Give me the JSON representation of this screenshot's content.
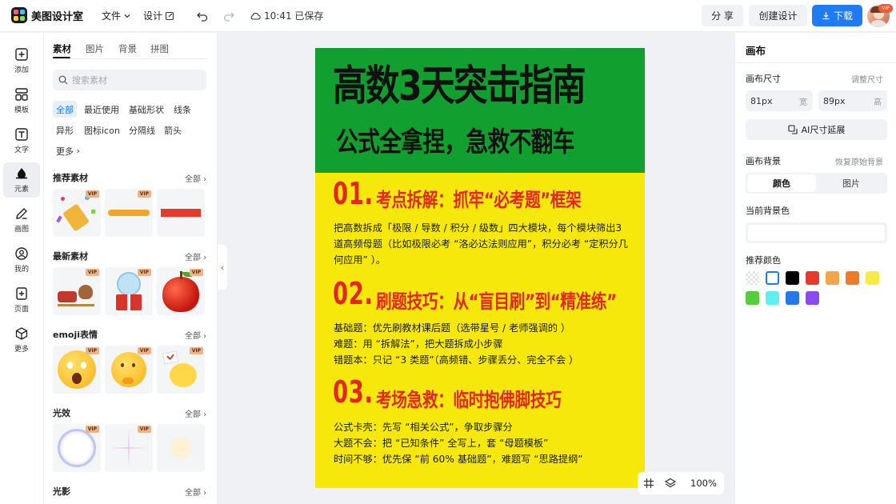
{
  "app": {
    "name": "美图设计室"
  },
  "topbar": {
    "file_label": "文件",
    "design_label": "设计",
    "saved_status": "10:41 已保存",
    "share_label": "分 享",
    "create_label": "创建设计",
    "download_label": "下载",
    "avatar_badge": "VIP"
  },
  "rail": {
    "items": [
      {
        "label": "添加",
        "icon": "plus-square-icon"
      },
      {
        "label": "模板",
        "icon": "template-icon"
      },
      {
        "label": "文字",
        "icon": "text-icon"
      },
      {
        "label": "元素",
        "icon": "shapes-icon"
      },
      {
        "label": "画图",
        "icon": "draw-icon"
      },
      {
        "label": "我的",
        "icon": "user-icon"
      },
      {
        "label": "页面",
        "icon": "page-add-icon"
      },
      {
        "label": "更多",
        "icon": "cube-icon"
      }
    ]
  },
  "panel": {
    "tabs": [
      "素材",
      "图片",
      "背景",
      "拼图"
    ],
    "search_placeholder": "搜索素材",
    "chips": [
      "全部",
      "最近使用",
      "基础形状",
      "线条",
      "异形",
      "图标icon",
      "分隔线",
      "箭头",
      "更多"
    ],
    "vip": "VIP",
    "all": "全部",
    "sections": [
      "推荐素材",
      "最新素材",
      "emoji表情",
      "光效",
      "光影"
    ]
  },
  "poster": {
    "title": "高数3天突击指南",
    "subtitle": "公式全拿捏，急救不翻车",
    "s1_num": "01.",
    "s1_head": "考点拆解：抓牢“必考题”框架",
    "s1_body": "把高数拆成「极限 / 导数 / 积分 / 级数」四大模块，每个模块筛出3 道高频母题（比如极限必考 “洛必达法则应用”，积分必考 “定积分几何应用” ）。",
    "s2_num": "02.",
    "s2_head": "刷题技巧：从“盲目刷”到“精准练”",
    "s2_line1": "基础题：优先刷教材课后题（选带星号 / 老师强调的 ）",
    "s2_line2": "难题：用 “拆解法”，把大题拆成小步骤",
    "s2_line3": "错题本：只记 “3 类题”（高频错、步骤丢分、完全不会 ）",
    "s3_num": "03.",
    "s3_head": "考场急救：临时抱佛脚技巧",
    "s3_line1": "公式卡壳：先写 “相关公式”，争取步骤分",
    "s3_line2": "大题不会：把 “已知条件” 全写上，套 “母题模板”",
    "s3_line3": "时间不够：优先保 “前 60% 基础题”，难题写 “思路提纲”"
  },
  "zoom": {
    "value": "100%"
  },
  "right_panel": {
    "title": "画布",
    "size_label": "画布尺寸",
    "adjust_size": "调整尺寸",
    "width_value": "81px",
    "width_unit": "宽",
    "height_value": "89px",
    "height_unit": "高",
    "ai_extend": "AI尺寸延展",
    "bg_label": "画布背景",
    "restore_bg": "恢复原始背景",
    "seg_color": "颜色",
    "seg_image": "图片",
    "current_bg": "当前背景色",
    "recommended": "推荐颜色"
  },
  "colors": {
    "accent": "#1e7bf0",
    "poster_green": "#11a030",
    "poster_yellow": "#f7e80b",
    "poster_red": "#e3261e",
    "swatches": [
      "transparent",
      "#ffffff",
      "#000000",
      "#e8392a",
      "#f2a54a",
      "#ee7a2a",
      "#f7ec45",
      "#58cc3c",
      "#5ef0f0",
      "#2677e8",
      "#8a4cf0"
    ]
  }
}
